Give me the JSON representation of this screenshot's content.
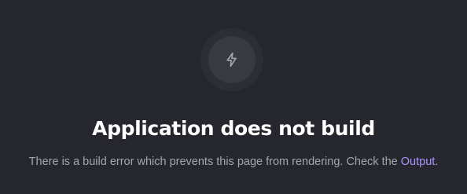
{
  "error": {
    "icon": "lightning-bolt-icon",
    "title": "Application does not build",
    "message_prefix": "There is a build error which prevents this page from rendering. Check the ",
    "link_label": "Output",
    "message_suffix": "."
  },
  "colors": {
    "background": "#25262e",
    "icon_outer": "#2d2e35",
    "icon_inner": "#393a41",
    "icon_stroke": "#a4a6b0",
    "title": "#ffffff",
    "message": "#a4a6b0",
    "link": "#a897ff"
  }
}
